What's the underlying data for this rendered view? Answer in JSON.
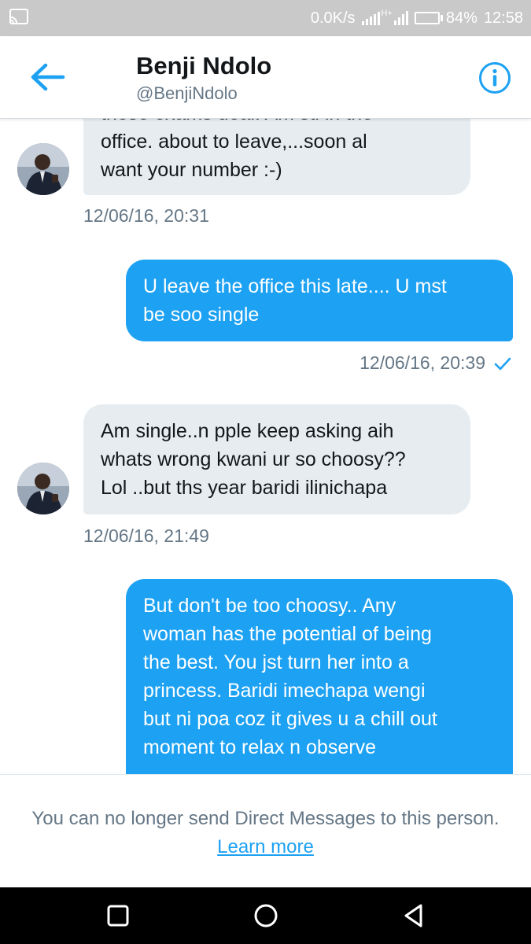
{
  "status_bar": {
    "speed": "0.0K/s",
    "network": "H+",
    "battery": "84%",
    "battery_level": 0.84,
    "time": "12:58",
    "icons": [
      "cast-icon",
      "signal-icon",
      "battery-icon"
    ]
  },
  "header": {
    "name": "Benji Ndolo",
    "handle": "@BenjiNdolo",
    "back_icon": "arrow-left-icon",
    "info_icon": "info-icon",
    "accent": "#1da1f2"
  },
  "messages": [
    {
      "direction": "incoming",
      "lines": [
        "these exams deal. Am stl in the",
        "office. about to leave,...soon al",
        "want your number :-)"
      ],
      "timestamp": "12/06/16, 20:31"
    },
    {
      "direction": "outgoing",
      "lines": [
        "U leave the office this late.... U mst",
        "be soo single"
      ],
      "timestamp": "12/06/16, 20:39",
      "read_icon": "checkmark-icon"
    },
    {
      "direction": "incoming",
      "lines": [
        "Am single..n pple keep asking aih",
        "whats wrong kwani ur so choosy??",
        "Lol ..but ths year baridi ilinichapa"
      ],
      "timestamp": "12/06/16, 21:49"
    },
    {
      "direction": "outgoing",
      "lines": [
        "But don't be too choosy.. Any",
        "woman has the potential of being",
        "the best. You jst turn her into a",
        "princess. Baridi imechapa wengi",
        "but ni poa coz it gives u a chill out",
        "moment to relax n observe"
      ]
    }
  ],
  "footer": {
    "notice": "You can no longer send Direct Messages to this person.",
    "link": "Learn more"
  },
  "nav": {
    "icons": [
      "recents-square-icon",
      "home-circle-icon",
      "back-triangle-icon"
    ]
  },
  "colors": {
    "incoming_bubble": "#e6ecf0",
    "outgoing_bubble": "#1da1f2",
    "text_secondary": "#657786"
  }
}
